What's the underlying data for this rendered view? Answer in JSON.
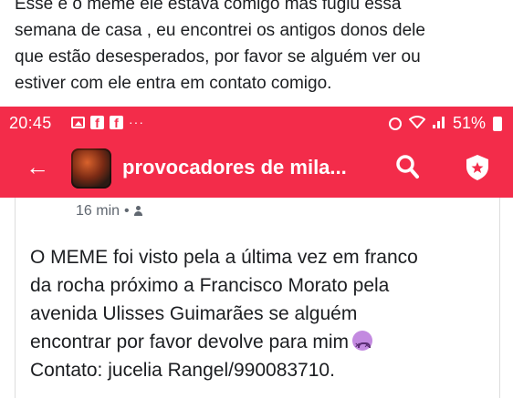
{
  "caption": {
    "text": "Esse é o meme ele estava comigo mas fugiu essa\nsemana de casa , eu encontrei os antigos donos dele\nque estão desesperados, por favor se alguém ver ou\nestiver com ele entra em contato comigo."
  },
  "status_bar": {
    "time": "20:45",
    "dots": "···",
    "battery": "51%",
    "background": "#f32c4a"
  },
  "app_bar": {
    "back_icon": "back-arrow-icon",
    "group_name": "provocadores de mila...",
    "search_icon": "search-icon",
    "shield_icon": "shield-icon"
  },
  "post": {
    "time": "16 min",
    "separator": "•",
    "privacy_icon": "group-members-icon",
    "lines": [
      "O MEME foi visto pela a última vez em franco",
      "da rocha próximo a Francisco  Morato  pela",
      "avenida Ulisses Guimarães se alguém",
      "encontrar por favor devolve para mim",
      "Contato: jucelia Rangel/990083710."
    ],
    "emoji": "dizzy-face-emoji"
  }
}
